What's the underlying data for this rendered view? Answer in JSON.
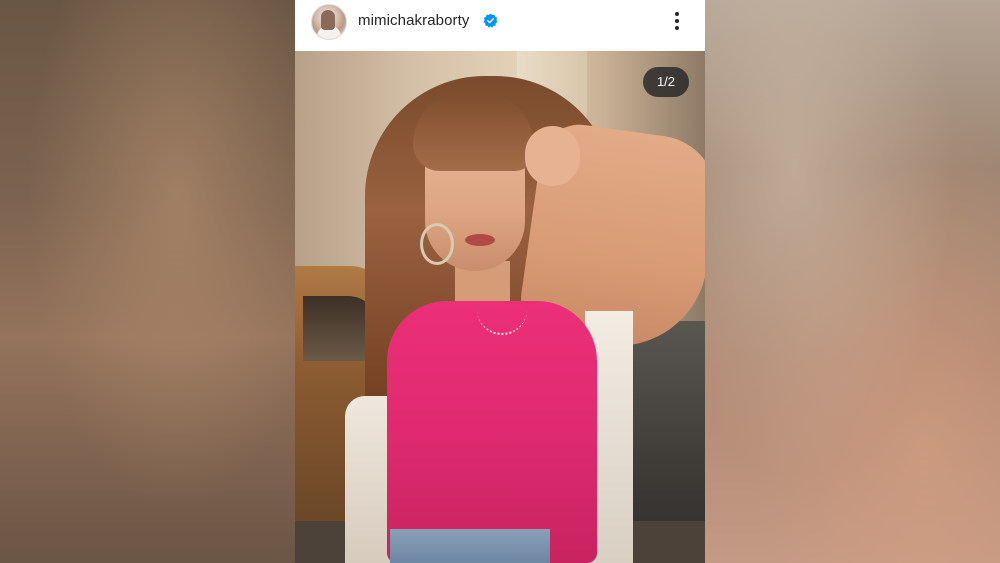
{
  "post": {
    "username": "mimichakraborty",
    "verified": true,
    "slide_counter": "1/2"
  },
  "icons": {
    "verified": "verified-badge-icon",
    "more": "more-options-icon",
    "avatar": "profile-avatar"
  },
  "colors": {
    "verified_blue": "#0095f6",
    "header_bg": "#ffffff",
    "text_primary": "#262626",
    "counter_bg": "#262626"
  }
}
